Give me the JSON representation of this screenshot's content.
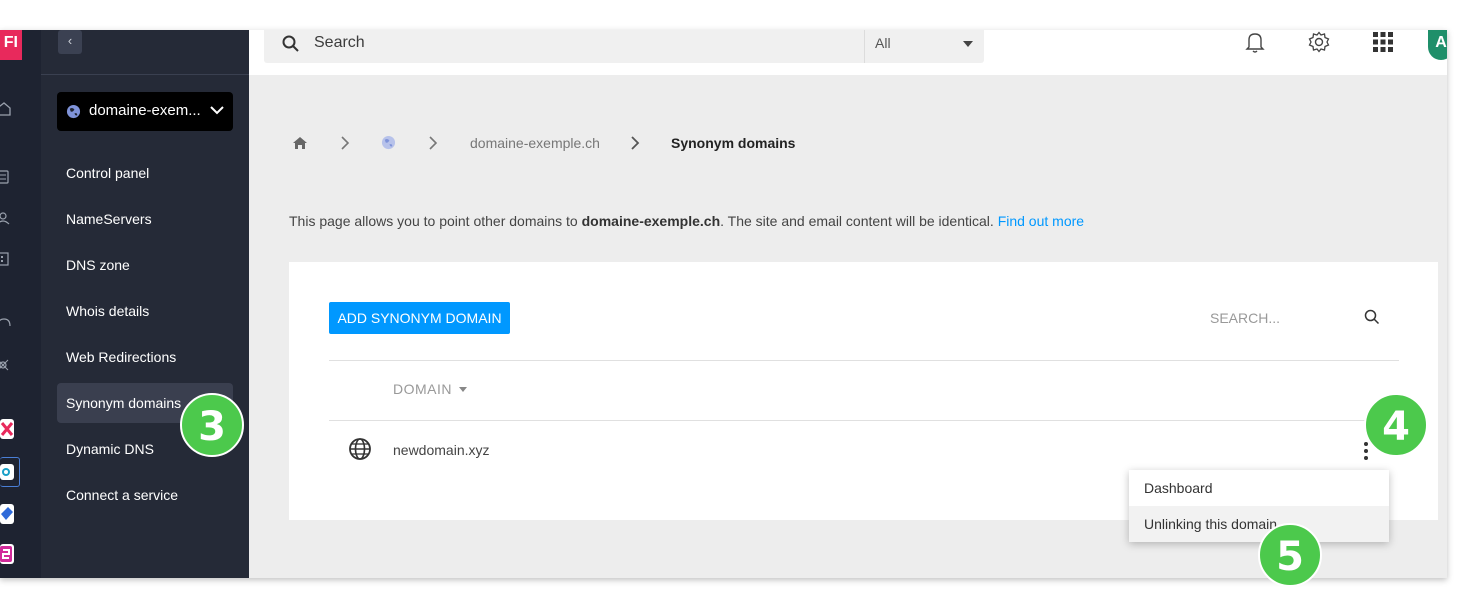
{
  "app": {
    "brand_letters": "FI"
  },
  "sidebar": {
    "collapse_label": "‹",
    "domain_selector": "domaine-exem...",
    "items": [
      {
        "label": "Control panel"
      },
      {
        "label": "NameServers"
      },
      {
        "label": "DNS zone"
      },
      {
        "label": "Whois details"
      },
      {
        "label": "Web Redirections"
      },
      {
        "label": "Synonym domains",
        "active": true
      },
      {
        "label": "Dynamic DNS"
      },
      {
        "label": "Connect a service"
      }
    ]
  },
  "topbar": {
    "search_placeholder": "Search",
    "search_scope": "All",
    "icons": [
      "bell-icon",
      "gear-icon",
      "apps-grid-icon"
    ],
    "avatar_letter": "A"
  },
  "breadcrumb": {
    "domain": "domaine-exemple.ch",
    "current": "Synonym domains"
  },
  "intro": {
    "prefix": "This page allows you to point other domains to ",
    "domain": "domaine-exemple.ch",
    "suffix": ". The site and email content will be identical. ",
    "link": "Find out more"
  },
  "card": {
    "add_button": "ADD SYNONYM DOMAIN",
    "search_placeholder": "SEARCH...",
    "column_header": "DOMAIN",
    "rows": [
      {
        "domain": "newdomain.xyz"
      }
    ]
  },
  "context_menu": {
    "items": [
      "Dashboard",
      "Unlinking this domain"
    ]
  },
  "badges": {
    "b3": "3",
    "b4": "4",
    "b5": "5"
  },
  "colors": {
    "accent": "#0098ff",
    "sidebar_bg": "#252a37",
    "badge": "#4cc94c",
    "brand": "#e8295c"
  }
}
